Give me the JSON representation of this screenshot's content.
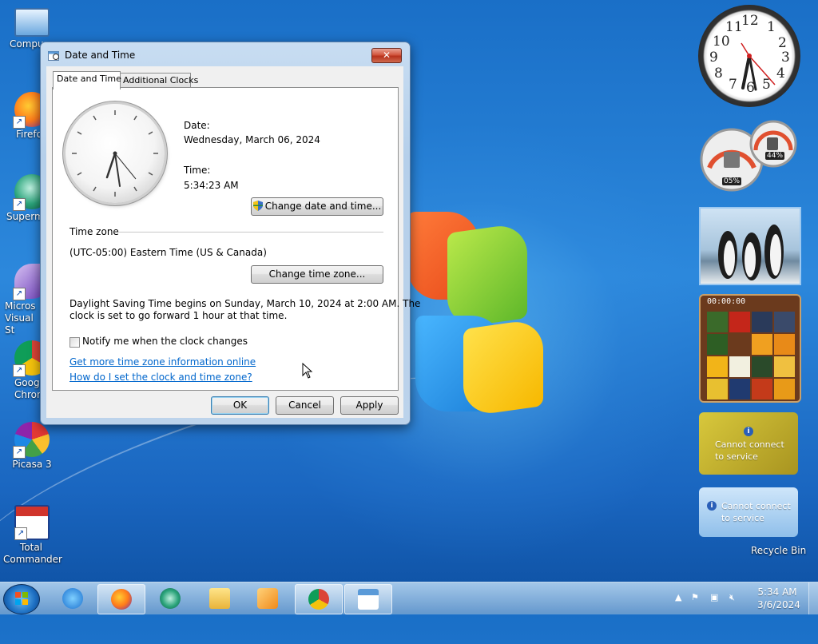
{
  "desktop": {
    "icons": [
      {
        "label": "Compu"
      },
      {
        "label": "Firefo"
      },
      {
        "label": "Superm"
      },
      {
        "label": "Micros Visual St"
      },
      {
        "label": "Googl Chron"
      },
      {
        "label": "Picasa 3"
      },
      {
        "label": "Total Commander"
      }
    ],
    "recycle_bin_label": "Recycle Bin"
  },
  "gadgets": {
    "clock_numbers": [
      "12",
      "1",
      "2",
      "3",
      "4",
      "5",
      "6",
      "7",
      "8",
      "9",
      "10",
      "11"
    ],
    "cpu_meter": {
      "cpu": "05%",
      "memory": "44%"
    },
    "puzzle_timer": "00:00:00",
    "weather_message": "Cannot connect to service",
    "feed_message": "Cannot connect to service"
  },
  "dialog": {
    "title": "Date and Time",
    "close_label": "✕",
    "tabs": [
      {
        "label": "Date and Time",
        "active": true
      },
      {
        "label": "Additional Clocks",
        "active": false
      }
    ],
    "date_label": "Date:",
    "date_value": "Wednesday, March 06, 2024",
    "time_label": "Time:",
    "time_value": "5:34:23 AM",
    "change_datetime_button": "Change date and time...",
    "timezone_heading": "Time zone",
    "timezone_value": "(UTC-05:00) Eastern Time (US & Canada)",
    "change_timezone_button": "Change time zone...",
    "dst_line1": "Daylight Saving Time begins on Sunday, March 10, 2024 at 2:00 AM. The",
    "dst_line2": "clock is set to go forward 1 hour at that time.",
    "notify_label": "Notify me when the clock changes",
    "notify_checked": false,
    "link_more_info": "Get more time zone information online",
    "link_how_to": "How do I set the clock and time zone?",
    "ok_button": "OK",
    "cancel_button": "Cancel",
    "apply_button": "Apply"
  },
  "taskbar": {
    "time": "5:34 AM",
    "date": "3/6/2024",
    "pinned": [
      {
        "name": "internet-explorer",
        "open": false
      },
      {
        "name": "firefox",
        "open": true
      },
      {
        "name": "supermium",
        "open": false
      },
      {
        "name": "file-explorer",
        "open": false
      },
      {
        "name": "media-player",
        "open": false
      },
      {
        "name": "chrome",
        "open": true
      },
      {
        "name": "date-time-control-panel",
        "open": true
      }
    ]
  },
  "colors": {
    "link": "#0066cc",
    "desktop_blue": "#1a6fc7",
    "close_red": "#c8422a"
  }
}
